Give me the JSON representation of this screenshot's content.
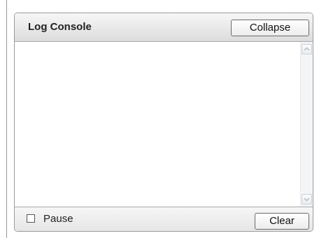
{
  "console": {
    "title": "Log Console",
    "collapse_label": "Collapse",
    "log_text": "",
    "pause_label": "Pause",
    "pause_checked": false,
    "clear_label": "Clear"
  },
  "icons": {
    "scroll_up": "chevron-up-icon",
    "scroll_down": "chevron-down-icon"
  }
}
